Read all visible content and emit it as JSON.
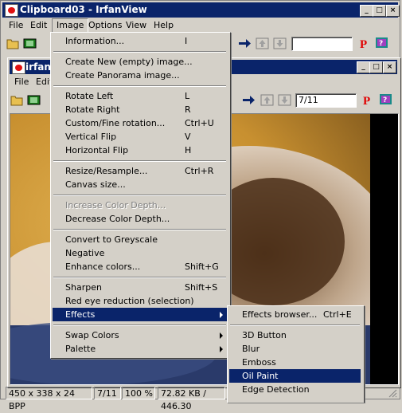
{
  "main_window": {
    "title": "Clipboard03 - IrfanView",
    "page_input": ""
  },
  "main_menu": [
    "File",
    "Edit",
    "Image",
    "Options",
    "View",
    "Help"
  ],
  "child_window": {
    "title": "irfan_",
    "page_input": "7/11"
  },
  "child_menu": [
    "File",
    "Edit"
  ],
  "image_menu": {
    "items": [
      {
        "label": "Information...",
        "shortcut": "I"
      },
      {
        "label": "Create New (empty) image..."
      },
      {
        "label": "Create Panorama image..."
      },
      {
        "label": "Rotate Left",
        "shortcut": "L"
      },
      {
        "label": "Rotate Right",
        "shortcut": "R"
      },
      {
        "label": "Custom/Fine rotation...",
        "shortcut": "Ctrl+U"
      },
      {
        "label": "Vertical Flip",
        "shortcut": "V"
      },
      {
        "label": "Horizontal Flip",
        "shortcut": "H"
      },
      {
        "label": "Resize/Resample...",
        "shortcut": "Ctrl+R"
      },
      {
        "label": "Canvas size..."
      },
      {
        "label": "Increase Color Depth..."
      },
      {
        "label": "Decrease Color Depth..."
      },
      {
        "label": "Convert to Greyscale"
      },
      {
        "label": "Negative"
      },
      {
        "label": "Enhance colors...",
        "shortcut": "Shift+G"
      },
      {
        "label": "Sharpen",
        "shortcut": "Shift+S"
      },
      {
        "label": "Red eye reduction (selection)"
      },
      {
        "label": "Effects"
      },
      {
        "label": "Swap Colors"
      },
      {
        "label": "Palette"
      }
    ]
  },
  "effects_menu": {
    "items": [
      {
        "label": "Effects browser...",
        "shortcut": "Ctrl+E"
      },
      {
        "label": "3D Button"
      },
      {
        "label": "Blur"
      },
      {
        "label": "Emboss"
      },
      {
        "label": "Oil Paint"
      },
      {
        "label": "Edge Detection"
      }
    ]
  },
  "status_bar": [
    "450 x 338 x 24 BPP",
    "7/11",
    "100 %",
    "72.82 KB / 446.30"
  ],
  "colors": {
    "title_active": "#0a246a",
    "title_inactive": "#0a246a",
    "menu_bg": "#d4d0c8",
    "highlight": "#0a246a"
  }
}
